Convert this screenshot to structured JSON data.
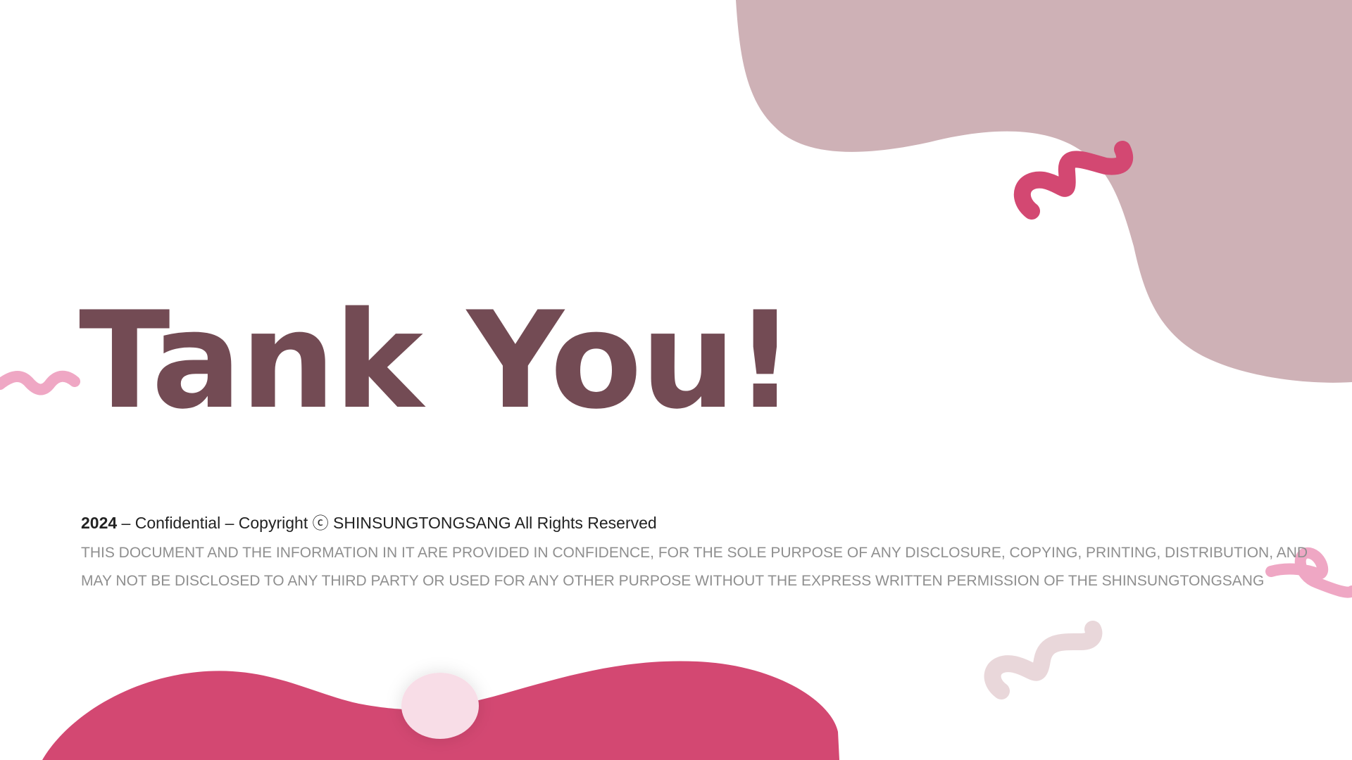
{
  "colors": {
    "background": "#ffffff",
    "blob_mauve": "#ceb1b6",
    "blob_pink": "#d34872",
    "circle_light_pink": "#f8dde7",
    "squiggle_dark_pink": "#d34872",
    "squiggle_light_pink": "#efa7c4",
    "squiggle_pale": "#e9d7da",
    "title": "#734b54",
    "copyright_text": "#222222",
    "disclaimer_text": "#8f8f8f"
  },
  "decorations": {
    "top_right_blob": "blob-shape",
    "bottom_blob": "blob-shape",
    "bottom_circle": "circle-shape",
    "squiggles": [
      "squiggle-icon",
      "squiggle-icon",
      "squiggle-icon",
      "squiggle-icon"
    ]
  },
  "slide": {
    "title": "Tank You!",
    "copyright": {
      "year": "2024",
      "text": " – Confidential – Copyright ⓒ SHINSUNGTONGSANG All Rights Reserved"
    },
    "disclaimer": {
      "line1": "THIS DOCUMENT AND THE INFORMATION IN IT ARE PROVIDED IN CONFIDENCE, FOR THE SOLE PURPOSE OF ANY DISCLOSURE, COPYING, PRINTING, DISTRIBUTION, AND",
      "line2": "MAY NOT BE DISCLOSED TO ANY THIRD PARTY OR USED FOR ANY OTHER PURPOSE WITHOUT THE EXPRESS WRITTEN PERMISSION OF THE SHINSUNGTONGSANG"
    }
  }
}
